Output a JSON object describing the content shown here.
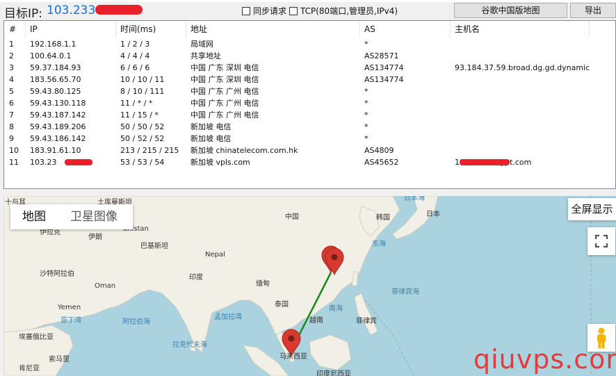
{
  "toolbar": {
    "target_label": "目标IP:",
    "target_ip": "103.233",
    "sync_label": "同步请求",
    "sync_checked": false,
    "tcp_label": "TCP(80端口,管理员,IPv4)",
    "tcp_checked": false,
    "map_button": "谷歌中国版地图",
    "export_button": "导出"
  },
  "table": {
    "headers": [
      "#",
      "IP",
      "时间(ms)",
      "地址",
      "AS",
      "主机名"
    ],
    "rows": [
      [
        "1",
        "192.168.1.1",
        "1 / 2 / 3",
        "局域网",
        "*",
        ""
      ],
      [
        "2",
        "100.64.0.1",
        "4 / 4 / 4",
        "共享地址",
        "AS28571",
        ""
      ],
      [
        "3",
        "59.37.184.93",
        "6 / 6 / 6",
        "中国 广东 深圳 电信",
        "AS134774",
        "93.184.37.59.broad.dg.gd.dynamic..."
      ],
      [
        "4",
        "183.56.65.70",
        "10 / 10 / 11",
        "中国 广东 深圳 电信",
        "AS134774",
        ""
      ],
      [
        "5",
        "59.43.80.125",
        "8 / 10 / 111",
        "中国 广东 广州 电信",
        "*",
        ""
      ],
      [
        "6",
        "59.43.130.118",
        "11 / * / *",
        "中国 广东 广州 电信",
        "*",
        ""
      ],
      [
        "7",
        "59.43.187.142",
        "11 / 15 / *",
        "中国 广东 广州 电信",
        "*",
        ""
      ],
      [
        "8",
        "59.43.189.206",
        "50 / 50 / 52",
        "新加坡 电信",
        "*",
        ""
      ],
      [
        "9",
        "59.43.186.142",
        "50 / 52 / 52",
        "新加坡 电信",
        "*",
        ""
      ],
      [
        "10",
        "183.91.61.10",
        "213 / 215 / 215",
        "新加坡 chinatelecom.com.hk",
        "AS4809",
        ""
      ],
      [
        "11",
        "103.23",
        "53 / 53 / 54",
        "新加坡 vpls.com",
        "AS45652",
        "10 .static.krypt.com"
      ]
    ]
  },
  "map": {
    "tab_map": "地图",
    "tab_satellite": "卫星图像",
    "fullscreen_label": "全屏显示",
    "labels": {
      "china": "中国",
      "korea": "韩国",
      "japan": "日本",
      "japan_sea": "日本海",
      "east_sea": "东海",
      "philippine_sea": "菲律宾海",
      "south_sea": "南海",
      "philippines": "菲律宾",
      "vietnam": "越南",
      "thailand": "泰国",
      "myanmar": "缅甸",
      "india": "印度",
      "nepal": "Nepal",
      "pakistan": "巴基斯坦",
      "afghanistan": "anistan",
      "iran": "伊朗",
      "iraq": "伊拉克",
      "saudi": "沙特阿拉伯",
      "oman": "Oman",
      "yemen": "Yemen",
      "ethiopia": "埃塞俄比亚",
      "somalia": "索马里",
      "kenya": "肯尼亚",
      "bengal_bay": "孟加拉湾",
      "arabian_sea": "阿拉伯海",
      "laccadive_sea": "拉克代夫海",
      "aden_gulf": "亚丁湾",
      "malaysia": "马来西亚",
      "kazakh": "十与耳",
      "turkmen": "土库曼斯坦",
      "indonesia": "印度尼西亚"
    },
    "route_color": "#1a8a1a",
    "marker_color": "#d93a2f"
  },
  "watermark": "qiuvps.com",
  "colors": {
    "accent_link": "#1a6dd6",
    "redaction": "#e8202a",
    "water": "#aad3df",
    "land": "#f2efe6"
  }
}
